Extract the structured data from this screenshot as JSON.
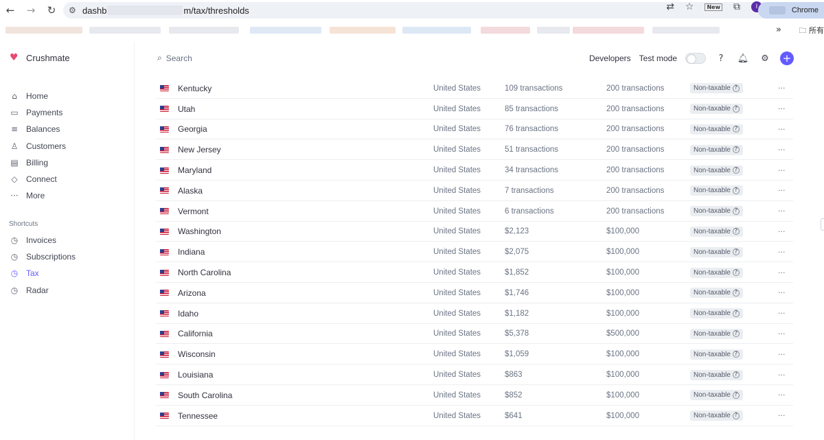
{
  "browser": {
    "url_start": "dashb",
    "url_end": "m/tax/thresholds",
    "new_badge": "New",
    "profile_initial": "I",
    "profile_label": "Chrome",
    "more_bookmarks": "»",
    "folder_label": "所有"
  },
  "sidebar": {
    "brand": "Crushmate",
    "items": [
      {
        "label": "Home",
        "icon": "home-icon"
      },
      {
        "label": "Payments",
        "icon": "payments-icon"
      },
      {
        "label": "Balances",
        "icon": "balances-icon"
      },
      {
        "label": "Customers",
        "icon": "customers-icon"
      },
      {
        "label": "Billing",
        "icon": "billing-icon"
      },
      {
        "label": "Connect",
        "icon": "connect-icon"
      },
      {
        "label": "More",
        "icon": "more-icon"
      }
    ],
    "shortcuts_title": "Shortcuts",
    "shortcuts": [
      {
        "label": "Invoices"
      },
      {
        "label": "Subscriptions"
      },
      {
        "label": "Tax"
      },
      {
        "label": "Radar"
      }
    ]
  },
  "header": {
    "search_placeholder": "Search",
    "developers": "Developers",
    "test_mode": "Test mode"
  },
  "table": {
    "status_label": "Non-taxable",
    "rows": [
      {
        "state": "Kentucky",
        "country": "United States",
        "count": "109 transactions",
        "threshold": "200 transactions"
      },
      {
        "state": "Utah",
        "country": "United States",
        "count": "85 transactions",
        "threshold": "200 transactions"
      },
      {
        "state": "Georgia",
        "country": "United States",
        "count": "76 transactions",
        "threshold": "200 transactions"
      },
      {
        "state": "New Jersey",
        "country": "United States",
        "count": "51 transactions",
        "threshold": "200 transactions"
      },
      {
        "state": "Maryland",
        "country": "United States",
        "count": "34 transactions",
        "threshold": "200 transactions"
      },
      {
        "state": "Alaska",
        "country": "United States",
        "count": "7 transactions",
        "threshold": "200 transactions"
      },
      {
        "state": "Vermont",
        "country": "United States",
        "count": "6 transactions",
        "threshold": "200 transactions"
      },
      {
        "state": "Washington",
        "country": "United States",
        "count": "$2,123",
        "threshold": "$100,000"
      },
      {
        "state": "Indiana",
        "country": "United States",
        "count": "$2,075",
        "threshold": "$100,000"
      },
      {
        "state": "North Carolina",
        "country": "United States",
        "count": "$1,852",
        "threshold": "$100,000"
      },
      {
        "state": "Arizona",
        "country": "United States",
        "count": "$1,746",
        "threshold": "$100,000"
      },
      {
        "state": "Idaho",
        "country": "United States",
        "count": "$1,182",
        "threshold": "$100,000"
      },
      {
        "state": "California",
        "country": "United States",
        "count": "$5,378",
        "threshold": "$500,000"
      },
      {
        "state": "Wisconsin",
        "country": "United States",
        "count": "$1,059",
        "threshold": "$100,000"
      },
      {
        "state": "Louisiana",
        "country": "United States",
        "count": "$863",
        "threshold": "$100,000"
      },
      {
        "state": "South Carolina",
        "country": "United States",
        "count": "$852",
        "threshold": "$100,000"
      },
      {
        "state": "Tennessee",
        "country": "United States",
        "count": "$641",
        "threshold": "$100,000"
      }
    ]
  }
}
